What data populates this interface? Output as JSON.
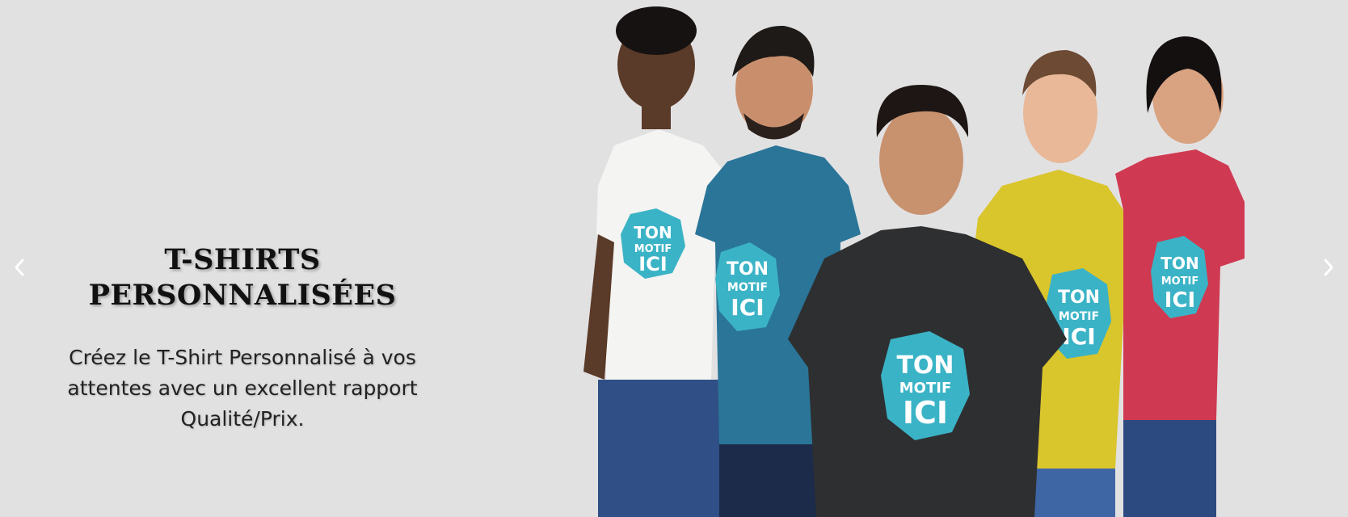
{
  "slide": {
    "title_line1": "T-SHIRTS",
    "title_line2": "PERSONNALISÉES",
    "subtitle_line1": "Créez le T-Shirt Personnalisé à vos",
    "subtitle_line2": "attentes avec un excellent rapport",
    "subtitle_line3": "Qualité/Prix."
  },
  "controls": {
    "prev_icon": "chevron-left-icon",
    "next_icon": "chevron-right-icon"
  },
  "image": {
    "shirt_print_line1": "TON",
    "shirt_print_line2": "MOTIF",
    "shirt_print_line3": "ICI",
    "shirt_colors": [
      "#f4f4f2",
      "#2a7598",
      "#2e2f31",
      "#d9c52c",
      "#cf3a52"
    ],
    "print_color": "#3bb3c6"
  },
  "colors": {
    "background": "#e2e1e2",
    "title": "#111111",
    "text": "#222222"
  }
}
